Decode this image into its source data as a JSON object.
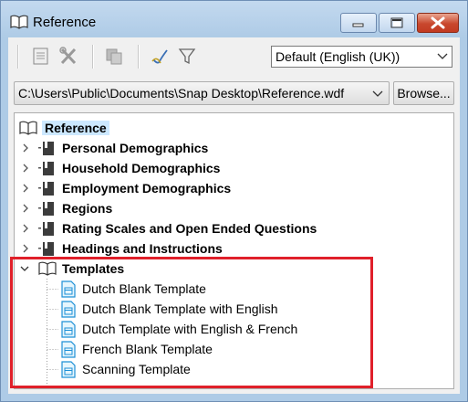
{
  "window": {
    "title": "Reference",
    "accent_title_bar": "#aecbe6",
    "close_button_color": "#c8482e"
  },
  "toolbar": {
    "buttons": [
      {
        "icon": "properties-icon"
      },
      {
        "icon": "tools-icon"
      },
      {
        "icon": "copy-icon"
      },
      {
        "icon": "select-icon"
      },
      {
        "icon": "filter-icon"
      }
    ],
    "language_select": {
      "value": "Default (English (UK))"
    }
  },
  "path": {
    "value": "C:\\Users\\Public\\Documents\\Snap Desktop\\Reference.wdf",
    "browse_label": "Browse..."
  },
  "tree": {
    "root": {
      "label": "Reference",
      "icon": "open-book-icon"
    },
    "folders": [
      {
        "label": "Personal Demographics",
        "icon": "closed-book-icon",
        "expanded": false
      },
      {
        "label": "Household Demographics",
        "icon": "closed-book-icon",
        "expanded": false
      },
      {
        "label": "Employment Demographics",
        "icon": "closed-book-icon",
        "expanded": false
      },
      {
        "label": "Regions",
        "icon": "closed-book-icon",
        "expanded": false
      },
      {
        "label": "Rating Scales and Open Ended Questions",
        "icon": "closed-book-icon",
        "expanded": false
      },
      {
        "label": "Headings and Instructions",
        "icon": "closed-book-icon",
        "expanded": false
      }
    ],
    "templates_folder": {
      "label": "Templates",
      "icon": "open-book-icon",
      "expanded": true,
      "items": [
        {
          "label": "Dutch Blank Template",
          "icon": "template-file-icon"
        },
        {
          "label": "Dutch Blank Template with English",
          "icon": "template-file-icon"
        },
        {
          "label": "Dutch Template with English & French",
          "icon": "template-file-icon"
        },
        {
          "label": "French Blank Template",
          "icon": "template-file-icon"
        },
        {
          "label": "Scanning Template",
          "icon": "template-file-icon"
        }
      ]
    },
    "highlight_color": "#e0202a"
  }
}
